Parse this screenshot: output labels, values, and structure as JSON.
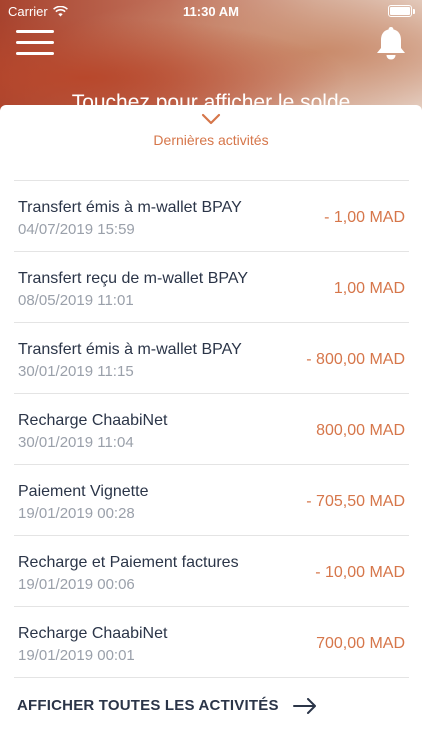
{
  "status_bar": {
    "carrier": "Carrier",
    "time": "11:30 AM"
  },
  "header": {
    "menu_icon": "hamburger-icon",
    "notification_icon": "bell-icon",
    "balance_prompt": "Touchez pour afficher le solde"
  },
  "activities": {
    "expand_icon": "chevron-down-icon",
    "title": "Dernières activités",
    "items": [
      {
        "label": "Transfert émis à m-wallet BPAY",
        "date": "04/07/2019 15:59",
        "amount": "- 1,00 MAD"
      },
      {
        "label": "Transfert reçu de m-wallet BPAY",
        "date": "08/05/2019 11:01",
        "amount": "1,00 MAD"
      },
      {
        "label": "Transfert émis à m-wallet BPAY",
        "date": "30/01/2019 11:15",
        "amount": "- 800,00 MAD"
      },
      {
        "label": "Recharge ChaabiNet",
        "date": "30/01/2019 11:04",
        "amount": "800,00 MAD"
      },
      {
        "label": "Paiement Vignette",
        "date": "19/01/2019 00:28",
        "amount": "- 705,50 MAD"
      },
      {
        "label": "Recharge et Paiement factures",
        "date": "19/01/2019 00:06",
        "amount": "- 10,00 MAD"
      },
      {
        "label": "Recharge ChaabiNet",
        "date": "19/01/2019 00:01",
        "amount": "700,00 MAD"
      }
    ],
    "show_all_label": "AFFICHER TOUTES LES ACTIVITÉS",
    "show_all_icon": "arrow-right-icon"
  },
  "colors": {
    "accent": "#d6764a",
    "text_primary": "#2b3548",
    "text_secondary": "#9aa0aa",
    "divider": "#e4e4e4"
  }
}
